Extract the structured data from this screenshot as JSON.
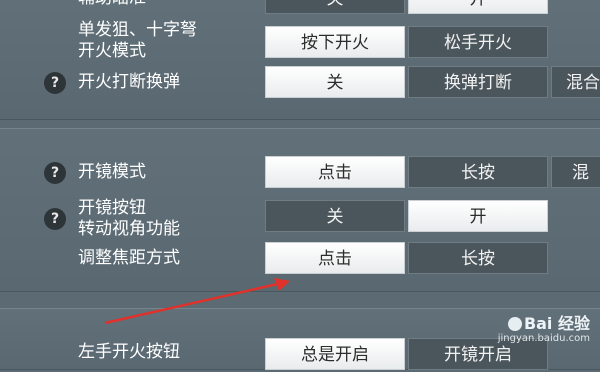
{
  "settings": {
    "row0": {
      "label": "辅助瞄准",
      "options": [
        "关",
        "开"
      ]
    },
    "row1": {
      "label_line1": "单发狙、十字弩",
      "label_line2": "开火模式",
      "options": [
        "按下开火",
        "松手开火"
      ]
    },
    "row2": {
      "label": "开火打断换弹",
      "options": [
        "关",
        "换弹打断",
        "混合"
      ]
    },
    "row3": {
      "label": "开镜模式",
      "options": [
        "点击",
        "长按",
        "混"
      ]
    },
    "row4": {
      "label_line1": "开镜按钮",
      "label_line2": "转动视角功能",
      "options": [
        "关",
        "开"
      ]
    },
    "row5": {
      "label": "调整焦距方式",
      "options": [
        "点击",
        "长按"
      ]
    },
    "row6": {
      "label": "左手开火按钮",
      "options": [
        "总是开启",
        "开镜开启"
      ]
    }
  },
  "help_glyph": "?",
  "watermark": {
    "brand": "Bai 经验",
    "site": "jingyan.baidu.com"
  },
  "arrow_color": "#e0322a"
}
